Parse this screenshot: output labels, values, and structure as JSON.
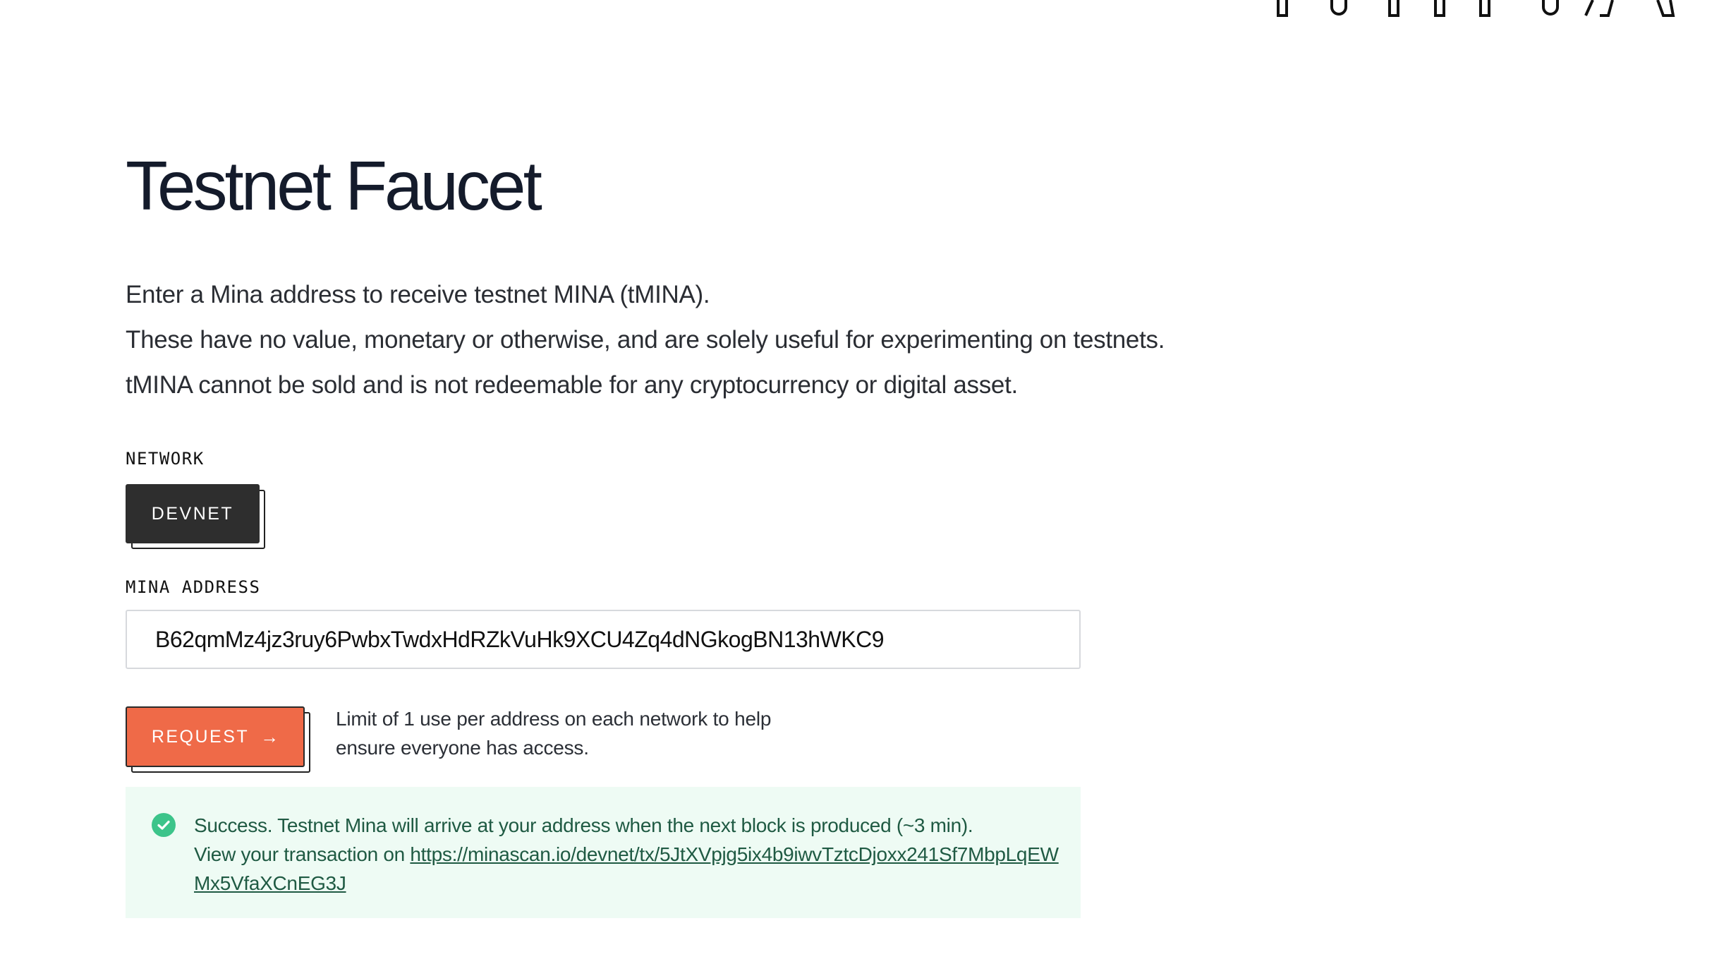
{
  "page": {
    "title": "Testnet Faucet"
  },
  "intro": {
    "line1": "Enter a Mina address to receive testnet MINA (tMINA).",
    "line2": "These have no value, monetary or otherwise, and are solely useful for experimenting on testnets.",
    "line3": "tMINA cannot be sold and is not redeemable for any cryptocurrency or digital asset."
  },
  "network": {
    "label": "NETWORK",
    "selected": "DEVNET"
  },
  "address": {
    "label": "MINA ADDRESS",
    "value": "B62qmMz4jz3ruy6PwbxTwdxHdRZkVuHk9XCU4Zq4dNGkogBN13hWKC9"
  },
  "request": {
    "button_label": "REQUEST",
    "arrow": "→",
    "limit_note": "Limit of 1 use per address on each network to help ensure everyone has access."
  },
  "success": {
    "message": "Success. Testnet Mina will arrive at your address when the next block is produced (~3 min).",
    "link_prefix": "View your transaction on ",
    "link_url": "https://minascan.io/devnet/tx/5JtXVpjg5ix4b9iwvTztcDjoxx241Sf7MbpLqEWMx5VfaXCnEG3J"
  },
  "icons": {
    "top_logo": "mina-logo-icon",
    "success": "check-circle-icon",
    "request_arrow": "arrow-right-icon"
  },
  "colors": {
    "request_button": "#ef6a48",
    "network_button": "#2e2e2e",
    "success_background": "#eefbf4",
    "success_text": "#1f5a43",
    "success_icon": "#3cc48a"
  }
}
